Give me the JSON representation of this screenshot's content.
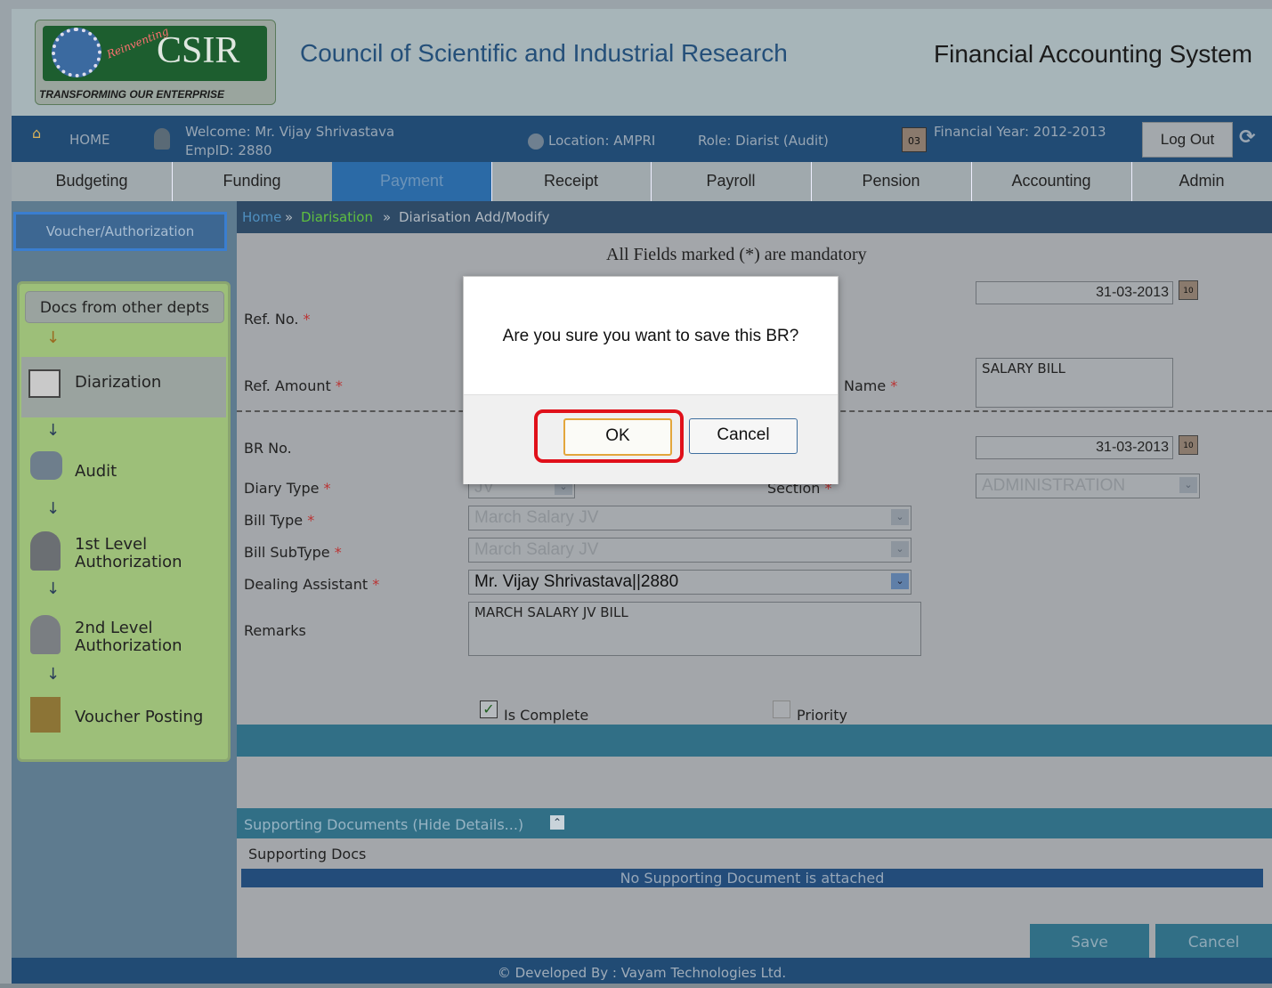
{
  "header": {
    "logo_reinventing": "Reinventing",
    "logo_csir": "CSIR",
    "logo_tagline": "TRANSFORMING OUR ENTERPRISE",
    "org_title": "Council of Scientific and Industrial Research",
    "app_title": "Financial Accounting System"
  },
  "infobar": {
    "home": "HOME",
    "welcome": "Welcome: Mr. Vijay Shrivastava",
    "empid": "EmpID: 2880",
    "location": "Location: AMPRI",
    "role": "Role: Diarist (Audit)",
    "calendar_day": "03",
    "financial_year": "Financial Year: 2012-2013",
    "logout": "Log Out"
  },
  "menu": [
    "Budgeting",
    "Funding",
    "Payment",
    "Receipt",
    "Payroll",
    "Pension",
    "Accounting",
    "Admin"
  ],
  "sidebar": {
    "top_button": "Voucher/Authorization",
    "docs_button": "Docs from other depts",
    "steps": [
      "Diarization",
      "Audit",
      "1st Level",
      "Authorization",
      "2nd Level",
      "Authorization",
      "Voucher Posting"
    ]
  },
  "breadcrumb": {
    "home": "Home",
    "sep1": "»",
    "diarisation": "Diarisation",
    "sep2": "»",
    "current": "Diarisation Add/Modify"
  },
  "form": {
    "mandatory_note": "All Fields marked (*) are mandatory",
    "ref_no_label": "Ref. No.",
    "ref_date_value": "31-03-2013",
    "ref_amount_label": "Ref. Amount",
    "name_label": "Name",
    "name_value": "SALARY BILL",
    "br_no_label": "BR No.",
    "br_date_value": "31-03-2013",
    "diary_type_label": "Diary Type",
    "diary_type_value": "JV",
    "section_label": "Section",
    "section_value": "ADMINISTRATION",
    "bill_type_label": "Bill Type",
    "bill_type_value": "March Salary JV",
    "bill_subtype_label": "Bill SubType",
    "bill_subtype_value": "March Salary JV",
    "dealing_assistant_label": "Dealing Assistant",
    "dealing_assistant_value": "Mr. Vijay Shrivastava||2880",
    "remarks_label": "Remarks",
    "remarks_value": "MARCH SALARY JV BILL",
    "is_complete_label": "Is Complete",
    "priority_label": "Priority",
    "required_mark": "*",
    "cal_icon_text": "10"
  },
  "supporting": {
    "header": "Supporting Documents (Hide Details...)",
    "docs_label": "Supporting Docs",
    "empty_message": "No Supporting Document is attached"
  },
  "footer_buttons": {
    "save": "Save",
    "cancel": "Cancel"
  },
  "footer": {
    "text": "© Developed By : Vayam Technologies Ltd."
  },
  "dialog": {
    "message": "Are you sure you want to save this BR?",
    "ok": "OK",
    "cancel": "Cancel"
  },
  "colors": {
    "highlight": "#e0101a",
    "infobar": "#214b74",
    "breadcrumb_green": "#5fbf3f"
  }
}
